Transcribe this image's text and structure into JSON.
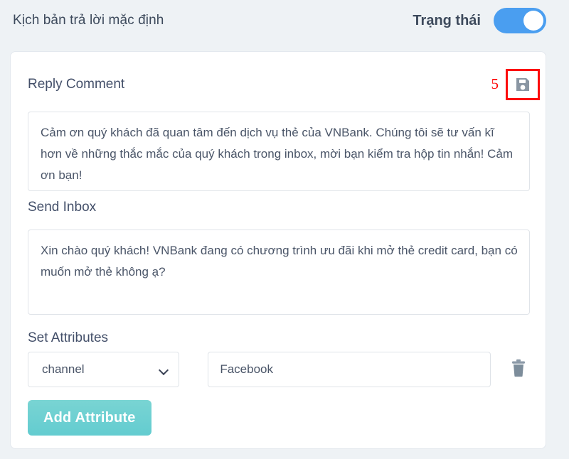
{
  "header": {
    "title": "Kịch bản trả lời mặc định",
    "status_label": "Trạng thái",
    "toggle_state": "on",
    "toggle_color": "#4a9ef0"
  },
  "card": {
    "reply": {
      "label": "Reply Comment",
      "value": "Cảm ơn quý khách đã quan tâm đến dịch vụ thẻ của VNBank. Chúng tôi sẽ tư vấn kĩ hơn về những thắc mắc của quý khách trong inbox, mời bạn kiểm tra hộp tin nhắn! Cảm ơn bạn!"
    },
    "annotation": {
      "number": "5",
      "color": "#ff0000"
    },
    "save_icon": "floppy-disk-save-icon",
    "send_inbox": {
      "label": "Send Inbox",
      "value": "Xin chào quý khách! VNBank đang có chương trình ưu đãi khi mở thẻ credit card, bạn có muốn mở thẻ không ạ?"
    },
    "set_attributes": {
      "label": "Set Attributes",
      "rows": [
        {
          "attribute": "channel",
          "value": "Facebook",
          "delete_icon": "trash-icon"
        }
      ],
      "add_button_label": "Add Attribute",
      "add_button_color": "#6fd0cf"
    }
  }
}
